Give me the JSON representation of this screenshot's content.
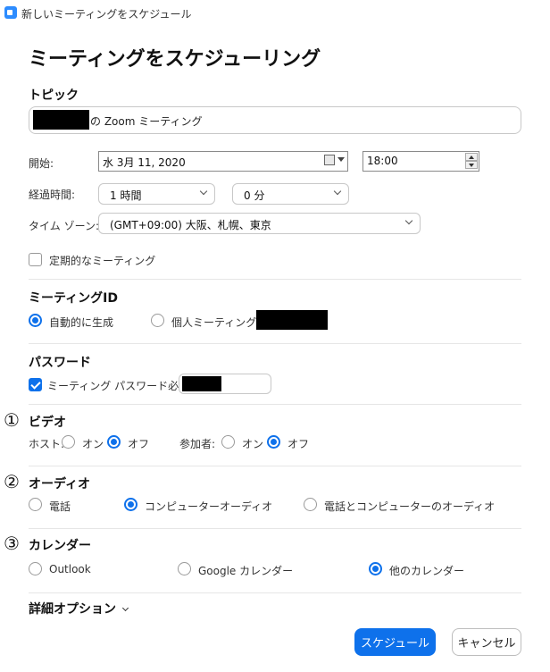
{
  "window": {
    "title": "新しいミーティングをスケジュール"
  },
  "heading": "ミーティングをスケジューリング",
  "topic": {
    "label": "トピック",
    "value": "の Zoom ミーティング"
  },
  "start": {
    "label": "開始:",
    "date": "水  3月  11, 2020",
    "time": "18:00"
  },
  "duration": {
    "label": "経過時間:",
    "hours": "1 時間",
    "minutes": "0 分"
  },
  "timezone": {
    "label": "タイム ゾーン:",
    "value": "(GMT+09:00) 大阪、札幌、東京"
  },
  "recurring": {
    "label": "定期的なミーティング",
    "checked": false
  },
  "meeting_id": {
    "title": "ミーティングID",
    "options": [
      {
        "label": "自動的に生成",
        "selected": true
      },
      {
        "label": "個人ミーティングID",
        "selected": false
      }
    ]
  },
  "password": {
    "title": "パスワード",
    "checkbox_label": "ミーティング パスワード必須",
    "checked": true
  },
  "video": {
    "marker": "①",
    "title": "ビデオ",
    "host_label": "ホスト:",
    "participant_label": "参加者:",
    "on_label": "オン",
    "off_label": "オフ",
    "host_value": "オフ",
    "participant_value": "オフ"
  },
  "audio": {
    "marker": "②",
    "title": "オーディオ",
    "options": [
      {
        "label": "電話",
        "selected": false
      },
      {
        "label": "コンピューターオーディオ",
        "selected": true
      },
      {
        "label": "電話とコンピューターのオーディオ",
        "selected": false
      }
    ]
  },
  "calendar": {
    "marker": "③",
    "title": "カレンダー",
    "options": [
      {
        "label": "Outlook",
        "selected": false
      },
      {
        "label": "Google カレンダー",
        "selected": false
      },
      {
        "label": "他のカレンダー",
        "selected": true
      }
    ]
  },
  "advanced": {
    "label": "詳細オプション"
  },
  "buttons": {
    "schedule": "スケジュール",
    "cancel": "キャンセル"
  },
  "colors": {
    "accent": "#0e71eb",
    "divider": "#e6e6e6",
    "redaction": "#000000"
  },
  "icons": [
    "zoom-app-icon",
    "calendar-icon",
    "dropdown-arrow-icon",
    "chevron-down-icon",
    "spinner-up-icon",
    "spinner-down-icon",
    "checkmark-icon"
  ]
}
